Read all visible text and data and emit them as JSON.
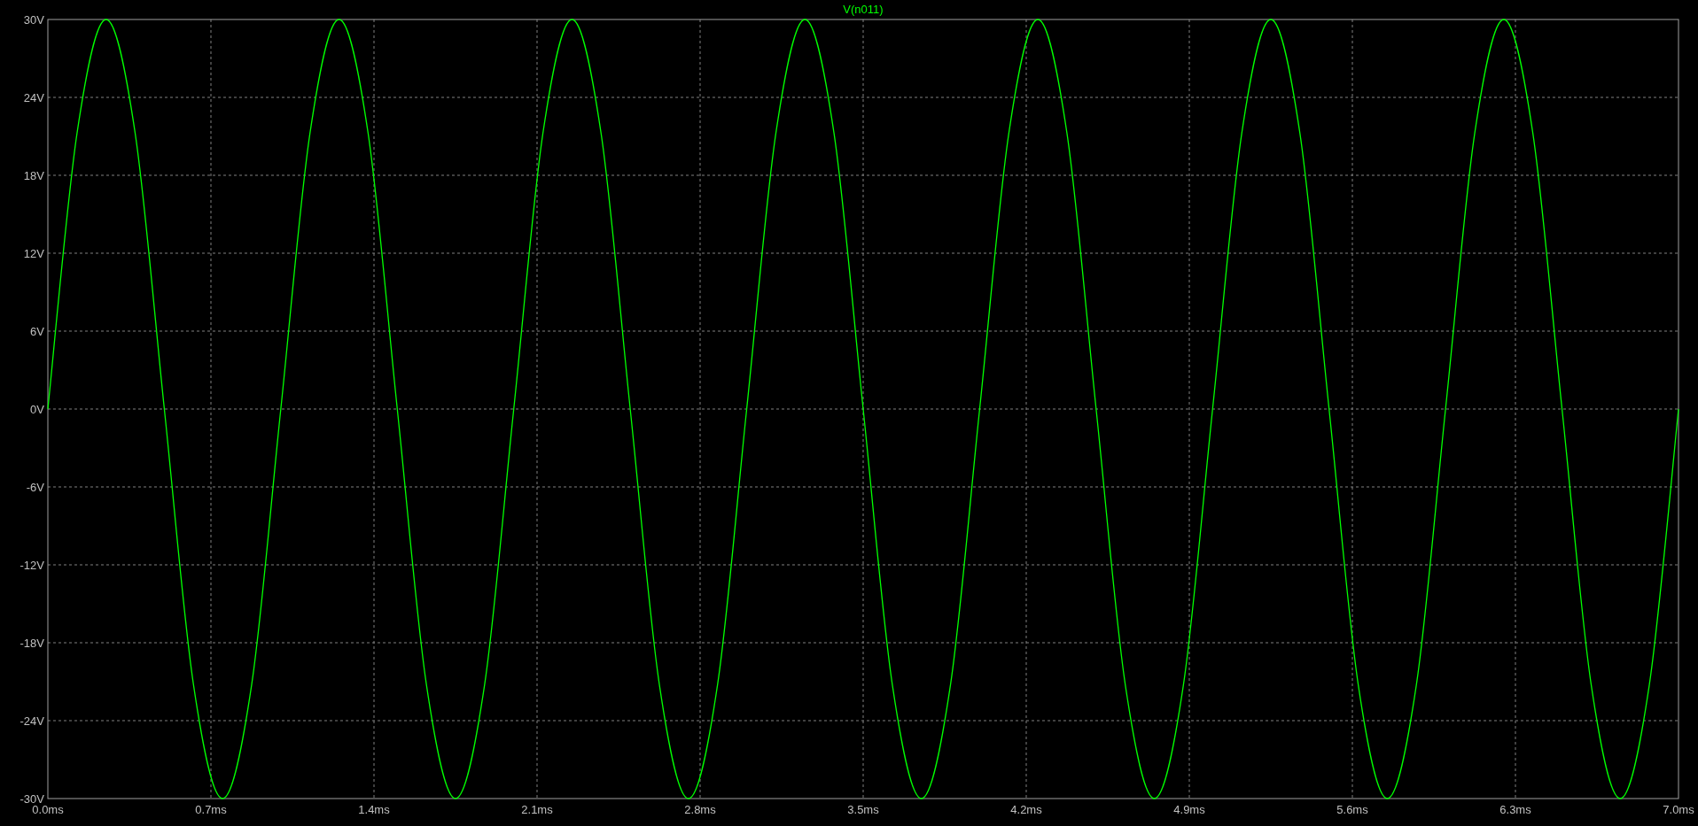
{
  "chart": {
    "chart_data": {
      "type": "line",
      "grid": true,
      "x": [
        0,
        0.125,
        0.25,
        0.375,
        0.5,
        0.625,
        0.75,
        0.875,
        1,
        1.125,
        1.25,
        1.375,
        1.5,
        1.625,
        1.75,
        1.875,
        2,
        2.125,
        2.25,
        2.375,
        2.5,
        2.625,
        2.75,
        2.875,
        3,
        3.125,
        3.25,
        3.375,
        3.5,
        3.625,
        3.75,
        3.875,
        4,
        4.125,
        4.25,
        4.375,
        4.5,
        4.625,
        4.75,
        4.875,
        5,
        5.125,
        5.25,
        5.375,
        5.5,
        5.625,
        5.75,
        5.875,
        6,
        6.125,
        6.25,
        6.375,
        6.5,
        6.625,
        6.75,
        6.875,
        7
      ],
      "series": [
        {
          "name": "V(n011)",
          "color": "#00ff00",
          "values": [
            0,
            21.21,
            30,
            21.21,
            0,
            -21.21,
            -30,
            -21.21,
            0,
            21.21,
            30,
            21.21,
            0,
            -21.21,
            -30,
            -21.21,
            0,
            21.21,
            30,
            21.21,
            0,
            -21.21,
            -30,
            -21.21,
            0,
            21.21,
            30,
            21.21,
            0,
            -21.21,
            -30,
            -21.21,
            0,
            21.21,
            30,
            21.21,
            0,
            -21.21,
            -30,
            -21.21,
            0,
            21.21,
            30,
            21.21,
            0,
            -21.21,
            -30,
            -21.21,
            0,
            21.21,
            30,
            21.21,
            0,
            -21.21,
            -30,
            -21.21,
            0
          ]
        }
      ],
      "xlim": [
        0,
        7
      ],
      "ylim": [
        -30,
        30
      ],
      "xticks": [
        {
          "value": 0,
          "label": "0.0ms"
        },
        {
          "value": 0.7,
          "label": "0.7ms"
        },
        {
          "value": 1.4,
          "label": "1.4ms"
        },
        {
          "value": 2.1,
          "label": "2.1ms"
        },
        {
          "value": 2.8,
          "label": "2.8ms"
        },
        {
          "value": 3.5,
          "label": "3.5ms"
        },
        {
          "value": 4.2,
          "label": "4.2ms"
        },
        {
          "value": 4.9,
          "label": "4.9ms"
        },
        {
          "value": 5.6,
          "label": "5.6ms"
        },
        {
          "value": 6.3,
          "label": "6.3ms"
        },
        {
          "value": 7,
          "label": "7.0ms"
        }
      ],
      "yticks": [
        {
          "value": 30,
          "label": "30V"
        },
        {
          "value": 24,
          "label": "24V"
        },
        {
          "value": 18,
          "label": "18V"
        },
        {
          "value": 12,
          "label": "12V"
        },
        {
          "value": 6,
          "label": "6V"
        },
        {
          "value": 0,
          "label": "0V"
        },
        {
          "value": -6,
          "label": "-6V"
        },
        {
          "value": -12,
          "label": "-12V"
        },
        {
          "value": -18,
          "label": "-18V"
        },
        {
          "value": -24,
          "label": "-24V"
        },
        {
          "value": -30,
          "label": "-30V"
        }
      ]
    }
  }
}
